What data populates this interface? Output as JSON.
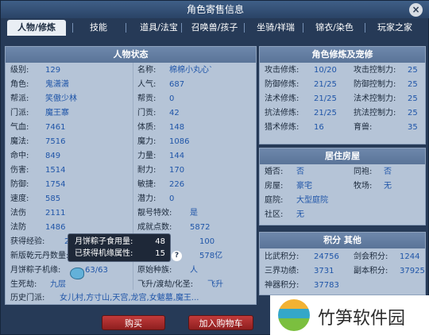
{
  "window": {
    "title": "角色寄售信息",
    "close_glyph": "×"
  },
  "tabs": [
    "人物/修炼",
    "技能",
    "道具/法宝",
    "召唤兽/孩子",
    "坐骑/祥瑞",
    "锦衣/染色",
    "玩家之家"
  ],
  "status_panel": {
    "title": "人物状态",
    "left": [
      {
        "label": "级别:",
        "value": "129"
      },
      {
        "label": "角色:",
        "value": "鬼潇潇"
      },
      {
        "label": "帮派:",
        "value": "笑傲少林"
      },
      {
        "label": "门派:",
        "value": "魔王寨"
      },
      {
        "label": "气血:",
        "value": "7461"
      },
      {
        "label": "魔法:",
        "value": "7516"
      },
      {
        "label": "命中:",
        "value": "849"
      },
      {
        "label": "伤害:",
        "value": "1514"
      },
      {
        "label": "防御:",
        "value": "1754"
      },
      {
        "label": "速度:",
        "value": "585"
      },
      {
        "label": "法伤",
        "value": "2111"
      },
      {
        "label": "法防",
        "value": "1486"
      },
      {
        "label": "获得经验:",
        "value": "26"
      },
      {
        "label": "新版乾元丹数量:",
        "value": ""
      },
      {
        "label": "月饼粽子机缘:",
        "value": "63/63"
      },
      {
        "label": "生死劫:",
        "value": "九层"
      }
    ],
    "right": [
      {
        "label": "名称:",
        "value": "棉棉小丸心`"
      },
      {
        "label": "人气:",
        "value": "687"
      },
      {
        "label": "帮贡:",
        "value": "0"
      },
      {
        "label": "门贡:",
        "value": "42"
      },
      {
        "label": "体质:",
        "value": "148"
      },
      {
        "label": "魔力:",
        "value": "1086"
      },
      {
        "label": "力量:",
        "value": "144"
      },
      {
        "label": "耐力:",
        "value": "170"
      },
      {
        "label": "敏捷:",
        "value": "226"
      },
      {
        "label": "潜力:",
        "value": "0"
      },
      {
        "label": "靓号特效:",
        "value": "是"
      },
      {
        "label": "成就点数:",
        "value": "5872"
      },
      {
        "label": "",
        "value": "100"
      },
      {
        "label": "",
        "value": "578亿"
      },
      {
        "label": "原始种族:",
        "value": "人"
      },
      {
        "label": "飞升/渡劫/化圣:",
        "value": "飞升"
      }
    ],
    "history": {
      "label": "历史门派:",
      "value": "女儿村,方寸山,天宫,龙宫,女魃墓,魔王..."
    }
  },
  "tooltip": {
    "line1_label": "月饼粽子食用量:",
    "line1_value": "48",
    "line2_label": "已获得机缘属性:",
    "line2_value": "15",
    "help": "?"
  },
  "cultivation_panel": {
    "title": "角色修炼及宠修",
    "rows": [
      {
        "l": "攻击修炼:",
        "v": "10/20",
        "l2": "攻击控制力:",
        "v2": "25"
      },
      {
        "l": "防御修炼:",
        "v": "21/25",
        "l2": "防御控制力:",
        "v2": "25"
      },
      {
        "l": "法术修炼:",
        "v": "21/25",
        "l2": "法术控制力:",
        "v2": "25"
      },
      {
        "l": "抗法修炼:",
        "v": "21/25",
        "l2": "抗法控制力:",
        "v2": "25"
      },
      {
        "l": "猎术修炼:",
        "v": "16",
        "l2": "育兽:",
        "v2": "35"
      }
    ]
  },
  "housing_panel": {
    "title": "居住房屋",
    "rows": [
      {
        "l": "婚否:",
        "v": "否",
        "l2": "同袍:",
        "v2": "否"
      },
      {
        "l": "房屋:",
        "v": "豪宅",
        "l2": "牧场:",
        "v2": "无"
      },
      {
        "l": "庭院:",
        "v": "大型庭院",
        "l2": "",
        "v2": ""
      },
      {
        "l": "社区:",
        "v": "无",
        "l2": "",
        "v2": ""
      }
    ]
  },
  "points_panel": {
    "title": "积分 其他",
    "rows": [
      {
        "l": "比武积分:",
        "v": "24756",
        "l2": "剑会积分:",
        "v2": "1244"
      },
      {
        "l": "三界功绩:",
        "v": "3731",
        "l2": "副本积分:",
        "v2": "37925"
      },
      {
        "l": "神器积分:",
        "v": "37783",
        "l2": "",
        "v2": ""
      }
    ]
  },
  "buttons": {
    "buy": "购买",
    "add_cart": "加入购物车"
  },
  "watermark": {
    "text": "竹笋软件园"
  },
  "colors": {
    "accent_blue": "#1f55a8",
    "panel_bg": "#b5c4d7",
    "button_red": "#a82c2c"
  }
}
